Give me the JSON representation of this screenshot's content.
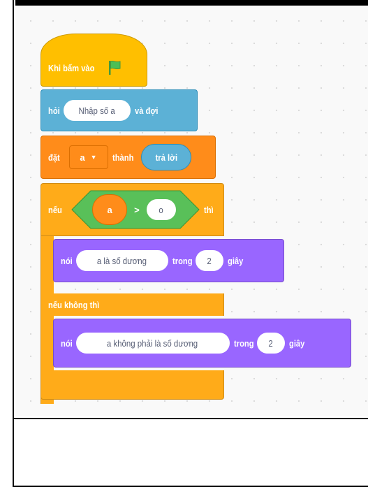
{
  "colors": {
    "events": "#ffbf00",
    "sensing": "#5cb1d6",
    "variables": "#ff8c1a",
    "control": "#ffab19",
    "operators": "#59c059",
    "looks": "#9966ff",
    "flag": "#4cbf56"
  },
  "scripts": {
    "when_flag": {
      "label": "Khi bấm vào",
      "icon": "green-flag-icon"
    },
    "ask": {
      "label": "hỏi",
      "question": "Nhập số a",
      "suffix": "và đợi"
    },
    "set_var": {
      "label": "đặt",
      "variable": "a",
      "to_label": "thành",
      "value_reporter": "trả lời"
    },
    "if_else": {
      "if_label": "nếu",
      "then_label": "thì",
      "else_label": "nếu không thì",
      "condition": {
        "left": "a",
        "operator": ">",
        "right": "o"
      }
    },
    "say_then": {
      "label": "nói",
      "message": "a là số dương",
      "for_label": "trong",
      "seconds": "2",
      "unit": "giây"
    },
    "say_else": {
      "label": "nói",
      "message": "a không phải là số dương",
      "for_label": "trong",
      "seconds": "2",
      "unit": "giây"
    }
  }
}
